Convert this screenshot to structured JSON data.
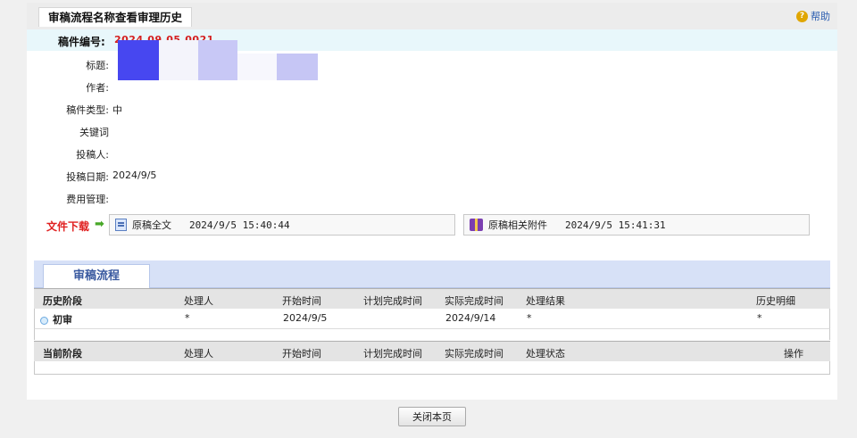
{
  "header": {
    "title": "审稿流程名称查看审理历史",
    "help_label": "帮助"
  },
  "manuscript": {
    "id_label": "稿件编号:",
    "id_value": "2024.09.05.0021",
    "fields": [
      {
        "label": "标题:",
        "value": ""
      },
      {
        "label": "作者:",
        "value": ""
      },
      {
        "label": "稿件类型:",
        "value": "中"
      },
      {
        "label": "关键词",
        "value": ""
      },
      {
        "label": "投稿人:",
        "value": ""
      },
      {
        "label": "投稿日期:",
        "value": "2024/9/5"
      },
      {
        "label": "费用管理:",
        "value": ""
      }
    ]
  },
  "downloads": {
    "label": "文件下载",
    "items": [
      {
        "name": "原稿全文",
        "time": "2024/9/5 15:40:44",
        "icon": "document-icon"
      },
      {
        "name": "原稿相关附件",
        "time": "2024/9/5 15:41:31",
        "icon": "archive-icon"
      }
    ]
  },
  "flow": {
    "tab_label": "审稿流程",
    "history_headers": [
      "历史阶段",
      "处理人",
      "开始时间",
      "计划完成时间",
      "实际完成时间",
      "处理结果",
      "历史明细"
    ],
    "history_rows": [
      {
        "stage": "初审",
        "handler": "*",
        "start": "2024/9/5",
        "planned": "",
        "actual": "2024/9/14",
        "result": "*",
        "detail": "*"
      }
    ],
    "current_headers": [
      "当前阶段",
      "处理人",
      "开始时间",
      "计划完成时间",
      "实际完成时间",
      "处理状态",
      "操作"
    ]
  },
  "footer": {
    "close_label": "关闭本页"
  },
  "colors": {
    "accent_red": "#d42020",
    "tab_blue": "#3a5aa0",
    "tab_bar": "#d7e1f7",
    "id_row_bg": "#e8f7fb"
  }
}
